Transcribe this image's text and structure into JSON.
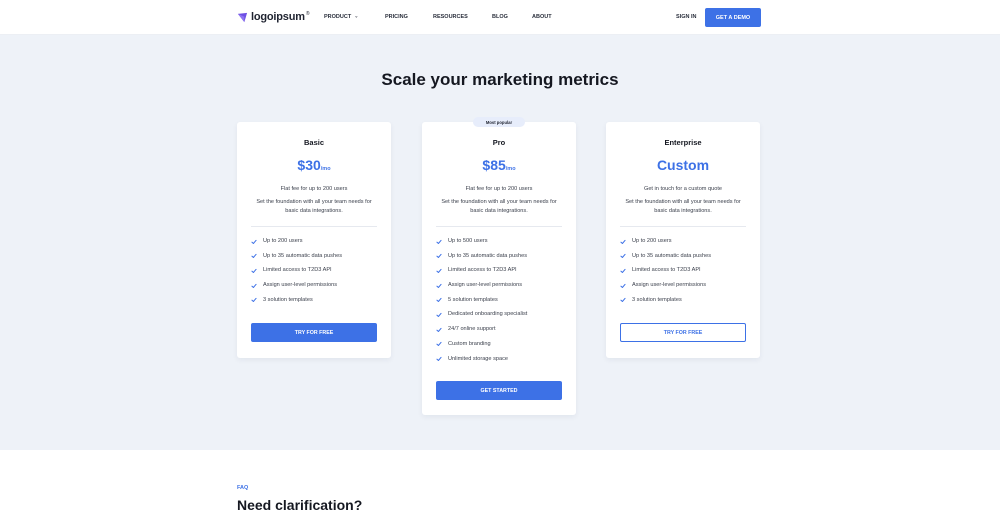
{
  "brand": {
    "name": "logoipsum",
    "trademark": "®",
    "accent": "#3d71e6",
    "logo_color": "#6d4fe4"
  },
  "nav": {
    "items": [
      {
        "label": "PRODUCT",
        "has_dropdown": true
      },
      {
        "label": "PRICING"
      },
      {
        "label": "RESOURCES"
      },
      {
        "label": "BLOG"
      },
      {
        "label": "ABOUT"
      }
    ],
    "signin": "SIGN IN",
    "demo": "GET A DEMO"
  },
  "hero": {
    "title": "Scale your marketing metrics"
  },
  "plans": [
    {
      "name": "Basic",
      "price": "$30",
      "period": "/mo",
      "tagline": "Flat fee for up to 200 users",
      "description": "Set the foundation with all your team needs for basic data integrations.",
      "features": [
        "Up to 200 users",
        "Up to 35 automatic data pushes",
        "Limited access to T2D3 API",
        "Assign user-level permissions",
        "3 solution templates"
      ],
      "cta": "TRY FOR FREE",
      "cta_style": "solid"
    },
    {
      "name": "Pro",
      "price": "$85",
      "period": "/mo",
      "badge": "Most popular",
      "tagline": "Flat fee for up to 200 users",
      "description": "Set the foundation with all your team needs for basic data integrations.",
      "features": [
        "Up to 500 users",
        "Up to 35 automatic data pushes",
        "Limited access to T2D3 API",
        "Assign user-level permissions",
        "5 solution templates",
        "Dedicated onboarding specialist",
        "24/7 online support",
        "Custom branding",
        "Unlimited storage space"
      ],
      "cta": "GET STARTED",
      "cta_style": "solid"
    },
    {
      "name": "Enterprise",
      "price": "Custom",
      "period": "",
      "tagline": "Get in touch for a custom quote",
      "description": "Set the foundation with all your team needs for basic data integrations.",
      "features": [
        "Up to 200 users",
        "Up to 35 automatic data pushes",
        "Limited access to T2D3 API",
        "Assign user-level permissions",
        "3 solution templates"
      ],
      "cta": "TRY FOR FREE",
      "cta_style": "outline"
    }
  ],
  "faq": {
    "label": "FAQ",
    "title": "Need clarification?"
  }
}
